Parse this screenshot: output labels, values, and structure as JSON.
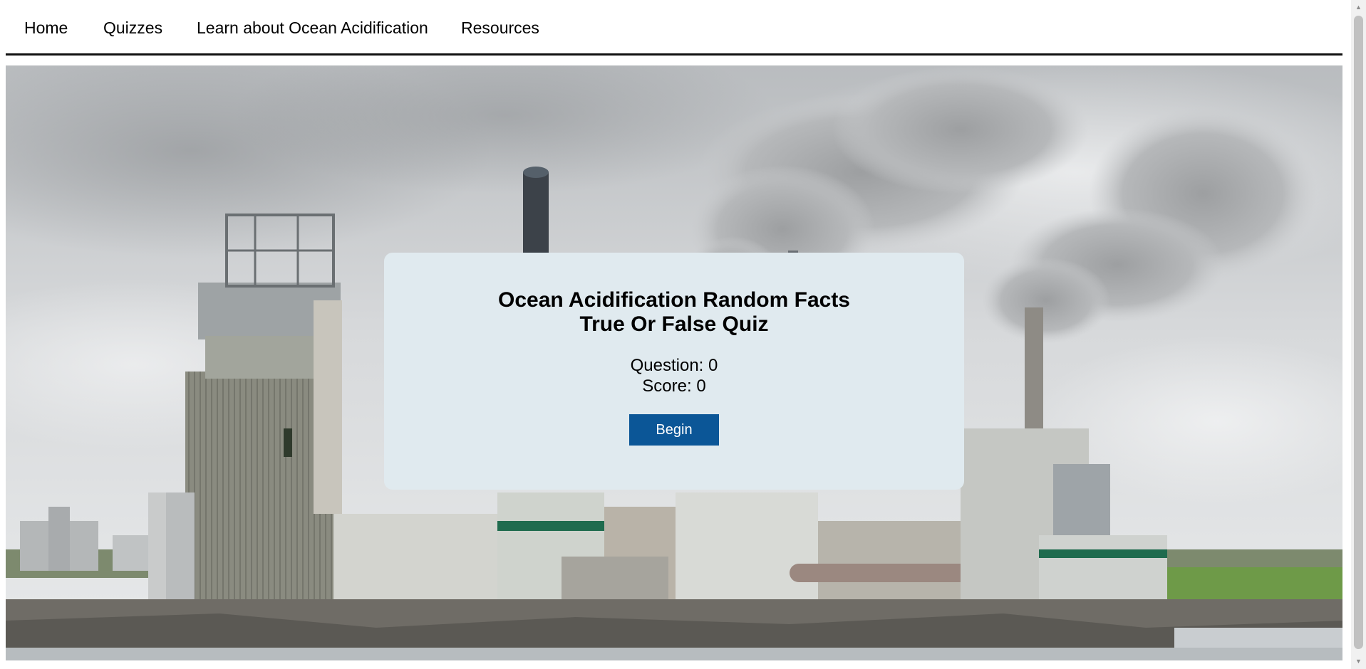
{
  "nav": {
    "items": [
      {
        "label": "Home"
      },
      {
        "label": "Quizzes"
      },
      {
        "label": "Learn about Ocean Acidification"
      },
      {
        "label": "Resources"
      }
    ]
  },
  "quiz": {
    "title_line1": "Ocean Acidification Random Facts",
    "title_line2": "True Or False Quiz",
    "question_text": "Question: 0",
    "score_text": "Score: 0",
    "begin_label": "Begin"
  },
  "colors": {
    "card_background": "#e0eaef",
    "button_background": "#0b5697",
    "button_text": "#ffffff",
    "nav_border": "#111111"
  },
  "icons": {
    "scroll_up": "triangle-up-icon",
    "scroll_down": "triangle-down-icon"
  }
}
